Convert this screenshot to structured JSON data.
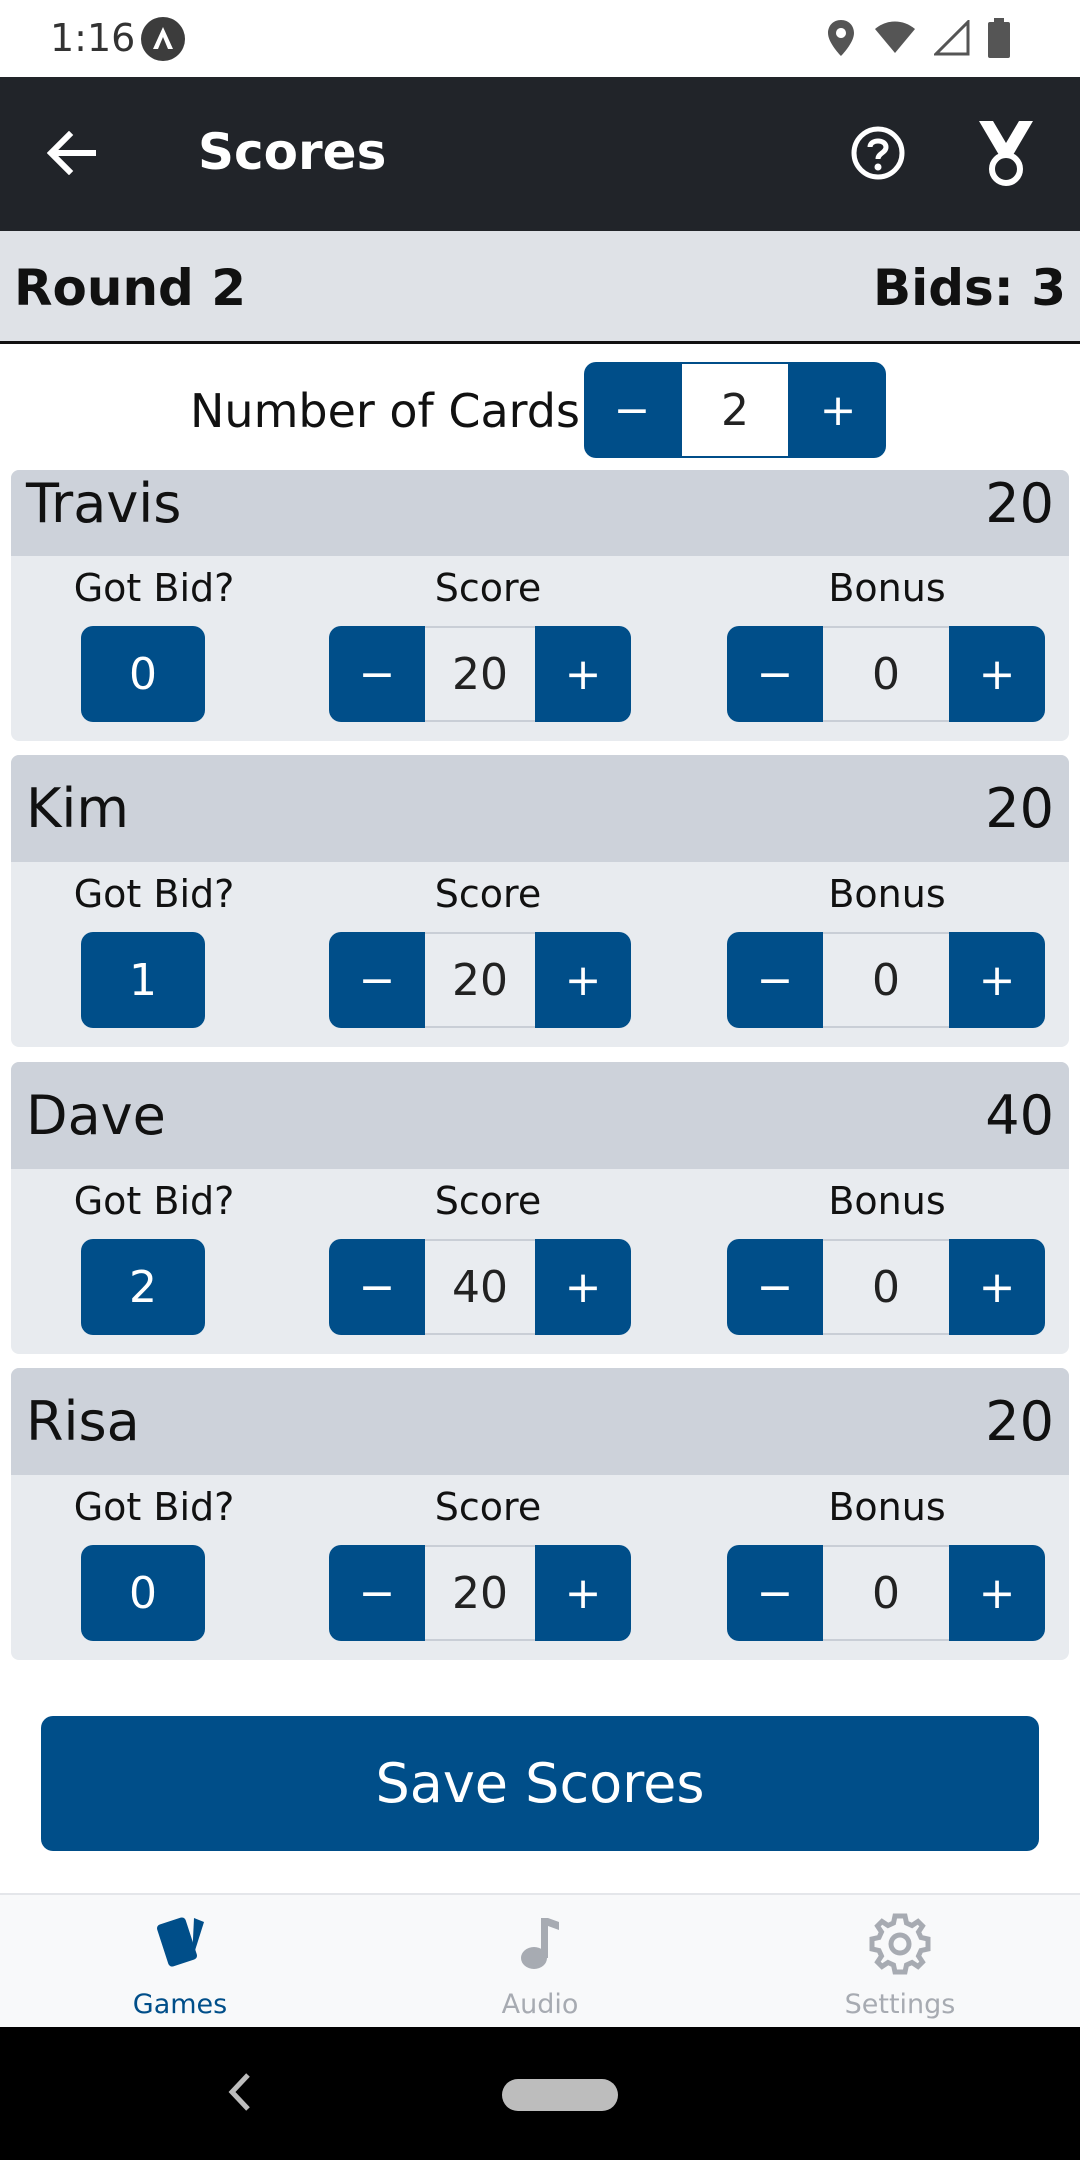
{
  "status_bar": {
    "time": "1:16"
  },
  "app_bar": {
    "title": "Scores"
  },
  "round_bar": {
    "round": "Round 2",
    "bids": "Bids: 3"
  },
  "cards": {
    "label": "Number of Cards",
    "value": "2",
    "minus": "−",
    "plus": "+"
  },
  "columns": {
    "got_bid": "Got Bid?",
    "score": "Score",
    "bonus": "Bonus"
  },
  "players": [
    {
      "name": "Travis",
      "total": "20",
      "got_bid": "0",
      "score": "20",
      "bonus": "0"
    },
    {
      "name": "Kim",
      "total": "20",
      "got_bid": "1",
      "score": "20",
      "bonus": "0"
    },
    {
      "name": "Dave",
      "total": "40",
      "got_bid": "2",
      "score": "40",
      "bonus": "0"
    },
    {
      "name": "Risa",
      "total": "20",
      "got_bid": "0",
      "score": "20",
      "bonus": "0"
    }
  ],
  "save": {
    "label": "Save Scores"
  },
  "bottom_nav": {
    "items": [
      {
        "label": "Games",
        "icon": "cards-icon",
        "active": true
      },
      {
        "label": "Audio",
        "icon": "music-note-icon",
        "active": false
      },
      {
        "label": "Settings",
        "icon": "gear-icon",
        "active": false
      }
    ]
  },
  "colors": {
    "primary": "#004e89",
    "appbar": "#212429",
    "player_header": "#cdd2da",
    "player_body": "#e8ebef"
  }
}
